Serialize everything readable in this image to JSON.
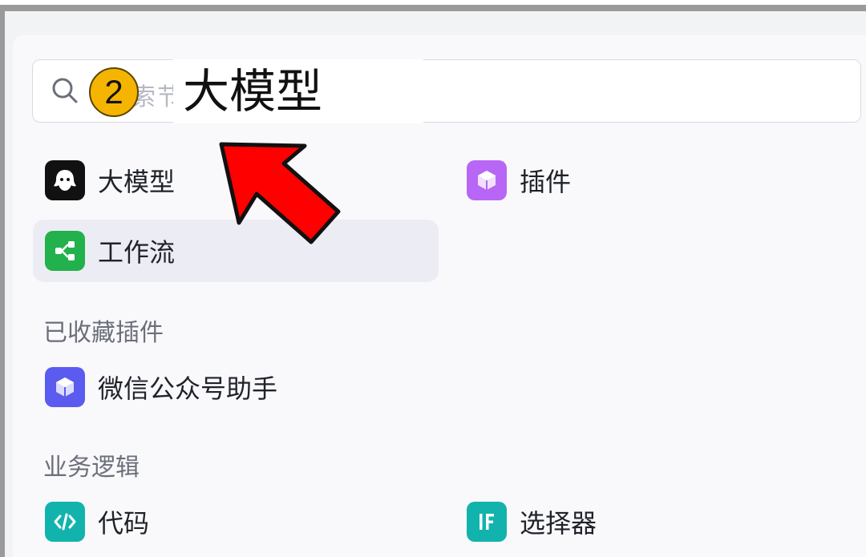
{
  "search": {
    "placeholder": "索节",
    "typed_overlay": "大模型",
    "step_badge": "2"
  },
  "nodes": {
    "llm": {
      "label": "大模型",
      "icon": "llm-icon",
      "color": "#111111"
    },
    "plugin": {
      "label": "插件",
      "icon": "plugin-cube-icon",
      "color": "#b866f5"
    },
    "workflow": {
      "label": "工作流",
      "icon": "workflow-icon",
      "color": "#22b14c"
    }
  },
  "favorites": {
    "title": "已收藏插件",
    "items": [
      {
        "label": "微信公众号助手",
        "icon": "plugin-cube-icon",
        "color": "#5b5bf0"
      }
    ]
  },
  "logic": {
    "title": "业务逻辑",
    "items": [
      {
        "label": "代码",
        "icon": "code-icon",
        "color": "#12b3ac"
      },
      {
        "label": "选择器",
        "icon": "if-icon",
        "color": "#12b3ac"
      }
    ]
  },
  "annotation": {
    "arrow_color": "#ff0000"
  }
}
